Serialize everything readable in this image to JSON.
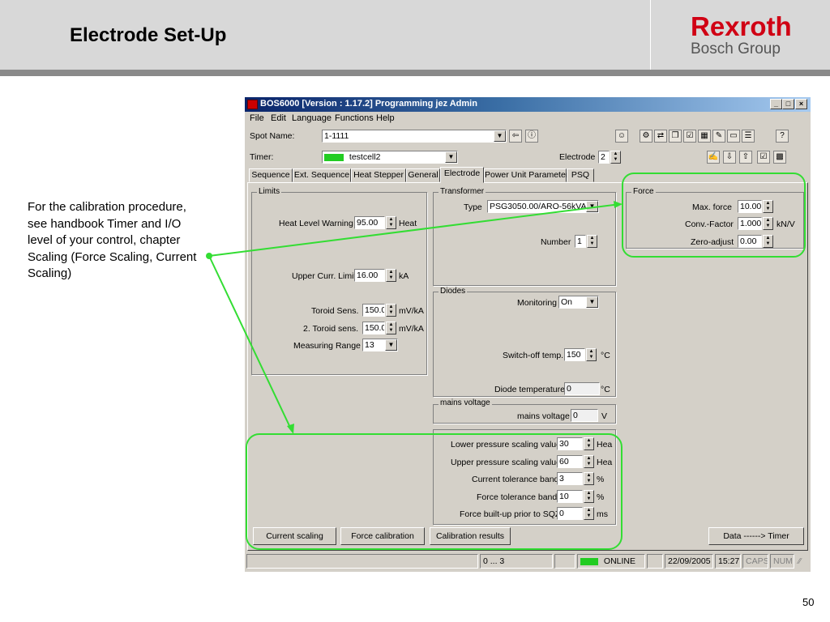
{
  "slide": {
    "title": "Electrode Set-Up",
    "logo": {
      "brand": "Rexroth",
      "sub": "Bosch Group"
    },
    "note": "For the calibration procedure, see handbook Timer and I/O level of your control, chapter Scaling (Force Scaling, Current Scaling)",
    "page_number": "50"
  },
  "app": {
    "window_title": "BOS6000 [Version : 1.17.2] Programming jez Admin",
    "menu": [
      "File",
      "Edit",
      "Language",
      "Functions",
      "Help"
    ],
    "spot_name": {
      "label": "Spot Name:",
      "value": "1-1111"
    },
    "timer": {
      "label": "Timer:",
      "value": "testcell2"
    },
    "electrode": {
      "label": "Electrode",
      "value": "2"
    },
    "tabs": [
      "Sequence",
      "Ext. Sequence",
      "Heat Stepper",
      "General",
      "Electrode",
      "Power Unit Parameter",
      "PSQ"
    ],
    "limits": {
      "title": "Limits",
      "heat_level_warning": {
        "label": "Heat Level Warning",
        "value": "95.00",
        "unit": "Heat"
      },
      "upper_curr_limit": {
        "label": "Upper Curr. Limit",
        "value": "16.00",
        "unit": "kA"
      },
      "toroid_sens": {
        "label": "Toroid Sens.",
        "value": "150.0",
        "unit": "mV/kA"
      },
      "toroid_sens2": {
        "label": "2. Toroid sens.",
        "value": "150.0",
        "unit": "mV/kA"
      },
      "measuring_range": {
        "label": "Measuring Range",
        "value": "13"
      }
    },
    "transformer": {
      "title": "Transformer",
      "type": {
        "label": "Type",
        "value": "PSG3050.00/ARO-56kVA"
      },
      "number": {
        "label": "Number",
        "value": "1"
      }
    },
    "diodes": {
      "title": "Diodes",
      "monitoring": {
        "label": "Monitoring",
        "value": "On"
      },
      "switch_off_temp": {
        "label": "Switch-off temp.",
        "value": "150",
        "unit": "°C"
      },
      "diode_temperature": {
        "label": "Diode temperature",
        "value": "0",
        "unit": "°C"
      }
    },
    "mains": {
      "title": "mains voltage",
      "mains_voltage": {
        "label": "mains voltage",
        "value": "0",
        "unit": "V"
      }
    },
    "force": {
      "title": "Force",
      "max_force": {
        "label": "Max. force",
        "value": "10.00"
      },
      "conv_factor": {
        "label": "Conv.-Factor",
        "value": "1.000",
        "unit": "kN/V"
      },
      "zero_adjust": {
        "label": "Zero-adjust",
        "value": "0.00"
      }
    },
    "scaling": {
      "lower_pressure": {
        "label": "Lower pressure scaling value",
        "value": "30",
        "unit": "Hea"
      },
      "upper_pressure": {
        "label": "Upper pressure scaling value",
        "value": "60",
        "unit": "Hea"
      },
      "current_tolerance": {
        "label": "Current tolerance band",
        "value": "3",
        "unit": "%"
      },
      "force_tolerance": {
        "label": "Force tolerance band",
        "value": "10",
        "unit": "%"
      },
      "force_buildup": {
        "label": "Force built-up prior to SQZ",
        "value": "0",
        "unit": "ms"
      }
    },
    "buttons": {
      "current_scaling": "Current scaling",
      "force_calibration": "Force calibration",
      "calibration_results": "Calibration results",
      "data_timer": "Data ------> Timer"
    },
    "status": {
      "range": "0 ... 3",
      "online": "ONLINE",
      "date": "22/09/2005",
      "time": "15:27",
      "caps": "CAPS",
      "num": "NUM"
    }
  },
  "colors": {
    "highlight": "#33dd33",
    "brand_red": "#d00014",
    "titlebar": "#0a246a"
  }
}
